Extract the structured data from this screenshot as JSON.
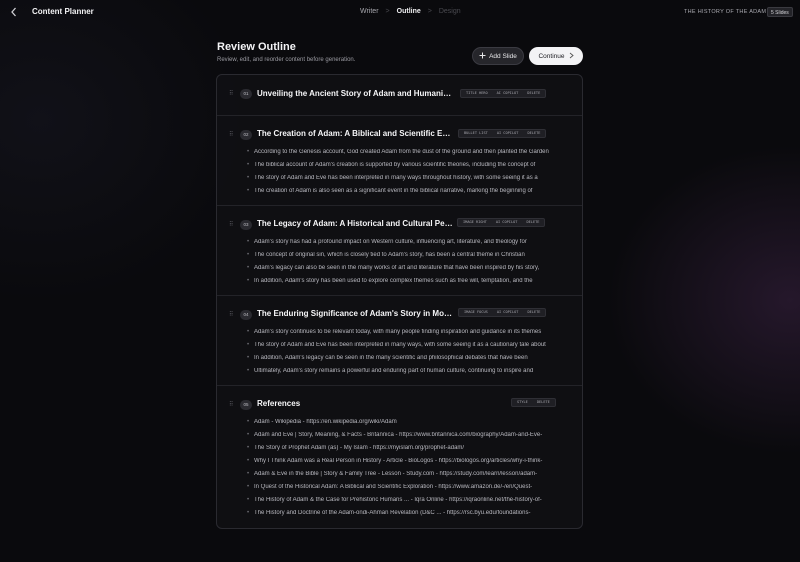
{
  "app": {
    "title": "Content Planner",
    "doc_title": "THE HISTORY OF THE ADAM",
    "slides_badge": "5 Slides"
  },
  "steps": [
    "Writer",
    ">",
    "Outline",
    ">",
    "Design"
  ],
  "header": {
    "title": "Review Outline",
    "subtitle": "Review, edit, and reorder content before generation.",
    "add_label": "Add Slide",
    "continue_label": "Continue"
  },
  "sections": [
    {
      "num": "01",
      "title": "Unveiling the Ancient Story of Adam and Humanity's Origin",
      "tags": [
        "TITLE HERO",
        "AI COPILOT",
        "DELETE"
      ],
      "bullets": []
    },
    {
      "num": "02",
      "title": "The Creation of Adam: A Biblical and Scientific Exploration",
      "tags": [
        "BULLET LIST",
        "AI COPILOT",
        "DELETE"
      ],
      "bullets": [
        "According to the Genesis account, God created Adam from the dust of the ground and then planted the Garden",
        "The biblical account of Adam's creation is supported by various scientific theories, including the concept of",
        "The story of Adam and Eve has been interpreted in many ways throughout history, with some seeing it as a",
        "The creation of Adam is also seen as a significant event in the biblical narrative, marking the beginning of"
      ]
    },
    {
      "num": "03",
      "title": "The Legacy of Adam: A Historical and Cultural Perspective",
      "tags": [
        "IMAGE RIGHT",
        "AI COPILOT",
        "DELETE"
      ],
      "bullets": [
        "Adam's story has had a profound impact on Western culture, influencing art, literature, and theology for",
        "The concept of original sin, which is closely tied to Adam's story, has been a central theme in Christian",
        "Adam's legacy can also be seen in the many works of art and literature that have been inspired by his story,",
        "In addition, Adam's story has been used to explore complex themes such as free will, temptation, and the"
      ]
    },
    {
      "num": "04",
      "title": "The Enduring Significance of Adam's Story in Modern Times",
      "tags": [
        "IMAGE FOCUS",
        "AI COPILOT",
        "DELETE"
      ],
      "bullets": [
        "Adam's story continues to be relevant today, with many people finding inspiration and guidance in its themes",
        "The story of Adam and Eve has been interpreted in many ways, with some seeing it as a cautionary tale about",
        "In addition, Adam's legacy can be seen in the many scientific and philosophical debates that have been",
        "Ultimately, Adam's story remains a powerful and enduring part of human culture, continuing to inspire and"
      ]
    },
    {
      "num": "05",
      "title": "References",
      "tags": [
        "STYLE",
        "DELETE"
      ],
      "bullets": [
        "Adam - Wikipedia - https://en.wikipedia.org/wiki/Adam",
        "Adam and Eve | Story, Meaning, & Facts - Britannica - https://www.britannica.com/biography/Adam-and-Eve-",
        "The Story of Prophet Adam (as) - My Islam - https://myislam.org/prophet-adam/",
        "Why I Think Adam was a Real Person in History - Article - BioLogos - https://biologos.org/articles/why-i-think-",
        "Adam & Eve in the Bible | Story & Family Tree - Lesson - Study.com - https://study.com/learn/lesson/adam-",
        "In Quest of the Historical Adam: A Biblical and Scientific Exploration - https://www.amazon.de/-/en/Quest-",
        "The History of Adam & the Case for Prehistoric Humans ... - Iqra Online - https://iqraonline.net/the-history-of-",
        "The History and Doctrine of the Adam-ondi-Ahman Revelation (D&C ... - https://rsc.byu.edu/foundations-"
      ]
    }
  ]
}
